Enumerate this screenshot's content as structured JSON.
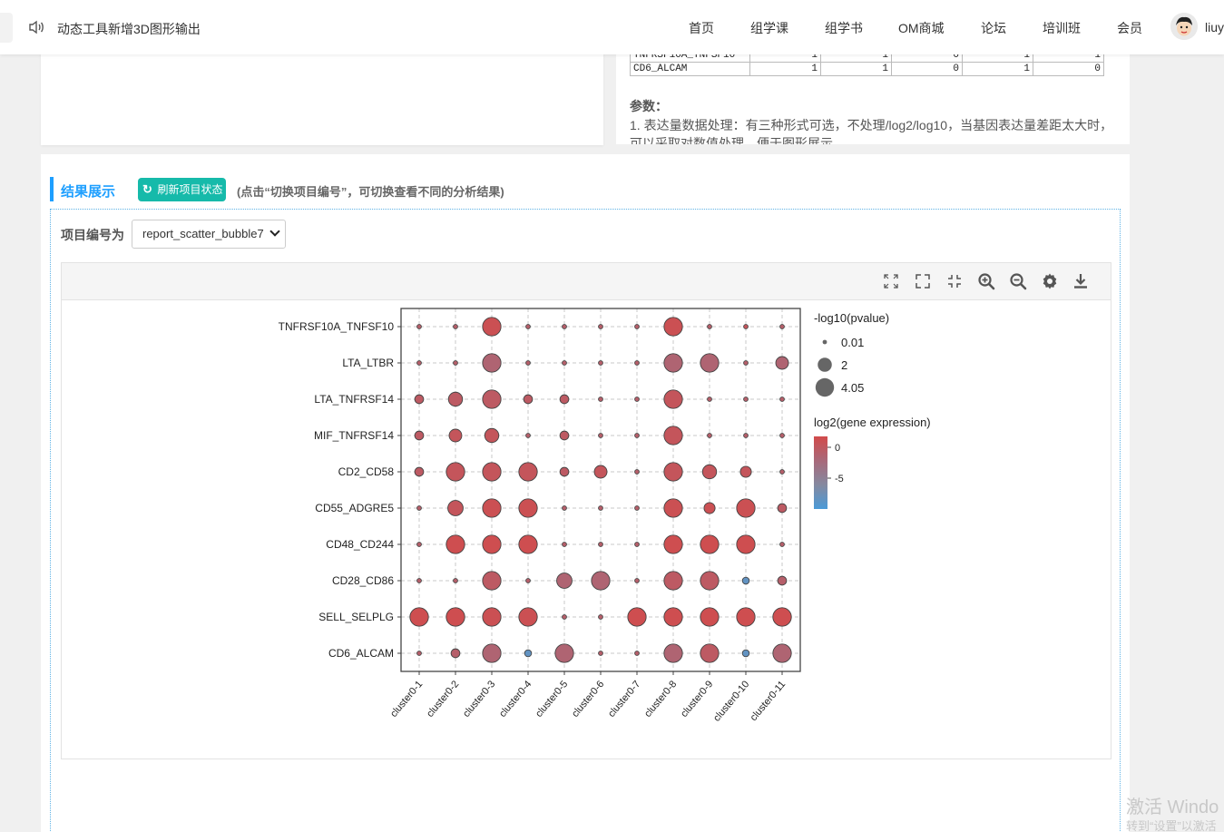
{
  "topbar": {
    "notice": "动态工具新增3D图形输出",
    "nav": [
      "首页",
      "组学课",
      "组学书",
      "OM商城",
      "论坛",
      "培训班",
      "会员"
    ],
    "username": "liuy"
  },
  "snippet_table": {
    "rows": [
      {
        "name": "TNFRSF10A_TNFSF10",
        "values": [
          "1",
          "1",
          "0",
          "1",
          "1"
        ]
      },
      {
        "name": "CD6_ALCAM",
        "values": [
          "1",
          "1",
          "0",
          "1",
          "0"
        ]
      }
    ]
  },
  "params": {
    "title": "参数：",
    "text": "1. 表达量数据处理：有三种形式可选，不处理/log2/log10，当基因表达量差距太大时，可以采取对数值处理，便于图形展示"
  },
  "results": {
    "title": "结果展示",
    "refresh_label": "刷新项目状态",
    "hint": "(点击“切换项目编号”，可切换查看不同的分析结果)",
    "project_label": "项目编号为",
    "project_value": "report_scatter_bubble7"
  },
  "toolbar": {
    "icons": [
      "expand-arrows-icon",
      "fullscreen-icon",
      "shrink-icon",
      "zoom-in-icon",
      "zoom-out-icon",
      "gear-icon",
      "download-icon"
    ]
  },
  "chart_data": {
    "type": "scatter",
    "subtype": "bubble",
    "x_categories": [
      "cluster0-1",
      "cluster0-2",
      "cluster0-3",
      "cluster0-4",
      "cluster0-5",
      "cluster0-6",
      "cluster0-7",
      "cluster0-8",
      "cluster0-9",
      "cluster0-10",
      "cluster0-11"
    ],
    "y_categories": [
      "TNFRSF10A_TNFSF10",
      "LTA_LTBR",
      "LTA_TNFRSF14",
      "MIF_TNFRSF14",
      "CD2_CD58",
      "CD55_ADGRE5",
      "CD48_CD244",
      "CD28_CD86",
      "SELL_SELPLG",
      "CD6_ALCAM"
    ],
    "size_legend": {
      "title": "-log10(pvalue)",
      "entries": [
        "0.01",
        "2",
        "4.05"
      ]
    },
    "color_legend": {
      "title": "log2(gene expression)",
      "ticks": [
        "0",
        "-5"
      ],
      "colors": [
        "#d24b4b",
        "#a8697a",
        "#8589a0",
        "#4a9ad8"
      ]
    },
    "grid": "dashed",
    "points": [
      {
        "gene": "TNFRSF10A_TNFSF10",
        "pvalue": [
          0.01,
          0.01,
          4.0,
          0.01,
          0.01,
          0.01,
          0.01,
          4.0,
          0.01,
          0.01,
          0.01
        ],
        "expr": [
          -2,
          -2,
          -0.5,
          -2,
          -2,
          -2,
          -2,
          -0.5,
          -2,
          -1,
          -2
        ]
      },
      {
        "gene": "LTA_LTBR",
        "pvalue": [
          0.01,
          0.01,
          4.0,
          0.01,
          0.01,
          0.01,
          0.01,
          4.0,
          4.0,
          0.01,
          1.5
        ],
        "expr": [
          -2,
          -2,
          -2.5,
          -2,
          -2,
          -2,
          -2,
          -2.5,
          -2.5,
          -2,
          -2.5
        ]
      },
      {
        "gene": "LTA_TNFRSF14",
        "pvalue": [
          0.5,
          2.0,
          4.0,
          0.5,
          0.5,
          0.01,
          0.01,
          4.0,
          0.01,
          0.01,
          0.01
        ],
        "expr": [
          -1.5,
          -1.5,
          -1.5,
          -1.5,
          -1.5,
          -2,
          -2,
          -1,
          -2,
          -2,
          -2
        ]
      },
      {
        "gene": "MIF_TNFRSF14",
        "pvalue": [
          0.5,
          1.5,
          2.0,
          0.01,
          0.5,
          0.01,
          0.01,
          4.0,
          0.01,
          0.01,
          0.01
        ],
        "expr": [
          -1.5,
          -1,
          -1,
          -2,
          -1.5,
          -2,
          -2,
          -1,
          -2,
          -2,
          -2
        ]
      },
      {
        "gene": "CD2_CD58",
        "pvalue": [
          0.5,
          4.0,
          4.0,
          4.0,
          0.5,
          1.5,
          0.01,
          4.0,
          2.0,
          1.0,
          0.01
        ],
        "expr": [
          -1.5,
          -1,
          -1,
          -1,
          -1.5,
          -1,
          -2,
          -1,
          -1,
          -1,
          -2
        ]
      },
      {
        "gene": "CD55_ADGRE5",
        "pvalue": [
          0.01,
          2.5,
          4.0,
          4.0,
          0.01,
          0.01,
          0.01,
          4.0,
          1.0,
          4.0,
          0.5
        ],
        "expr": [
          -2,
          -1,
          -0.5,
          -0.5,
          -2,
          -2,
          -2,
          -0.5,
          -0.5,
          -0.5,
          -1.5
        ]
      },
      {
        "gene": "CD48_CD244",
        "pvalue": [
          0.01,
          4.0,
          4.0,
          4.0,
          0.01,
          0.01,
          0.01,
          4.0,
          4.0,
          4.0,
          0.01
        ],
        "expr": [
          -2,
          -0.3,
          -0.3,
          -0.3,
          -2,
          -2,
          -2,
          -0.3,
          -0.3,
          -0.3,
          -2
        ]
      },
      {
        "gene": "CD28_CD86",
        "pvalue": [
          0.01,
          0.01,
          4.0,
          0.01,
          2.5,
          4.0,
          0.01,
          4.0,
          4.0,
          0.2,
          0.5
        ],
        "expr": [
          -2,
          -2,
          -1.5,
          -2,
          -2.5,
          -2.5,
          -2,
          -1.5,
          -1.5,
          -7,
          -2
        ]
      },
      {
        "gene": "SELL_SELPLG",
        "pvalue": [
          4.05,
          4.05,
          4.0,
          4.0,
          0.01,
          0.01,
          4.0,
          4.0,
          4.0,
          4.0,
          4.05
        ],
        "expr": [
          -0.3,
          -0.3,
          -0.5,
          -0.5,
          -2,
          -2,
          -0.3,
          -0.3,
          -0.3,
          -0.3,
          -0.3
        ]
      },
      {
        "gene": "CD6_ALCAM",
        "pvalue": [
          0.01,
          0.5,
          4.0,
          0.2,
          4.0,
          0.01,
          0.01,
          4.0,
          4.0,
          0.2,
          4.0
        ],
        "expr": [
          -2,
          -2,
          -2.5,
          -7,
          -2.5,
          -2,
          -2,
          -2.5,
          -1.5,
          -7,
          -2.5
        ]
      }
    ]
  },
  "watermark": {
    "line1": "激活 Windo",
    "line2": "转到“设置”以激活"
  }
}
